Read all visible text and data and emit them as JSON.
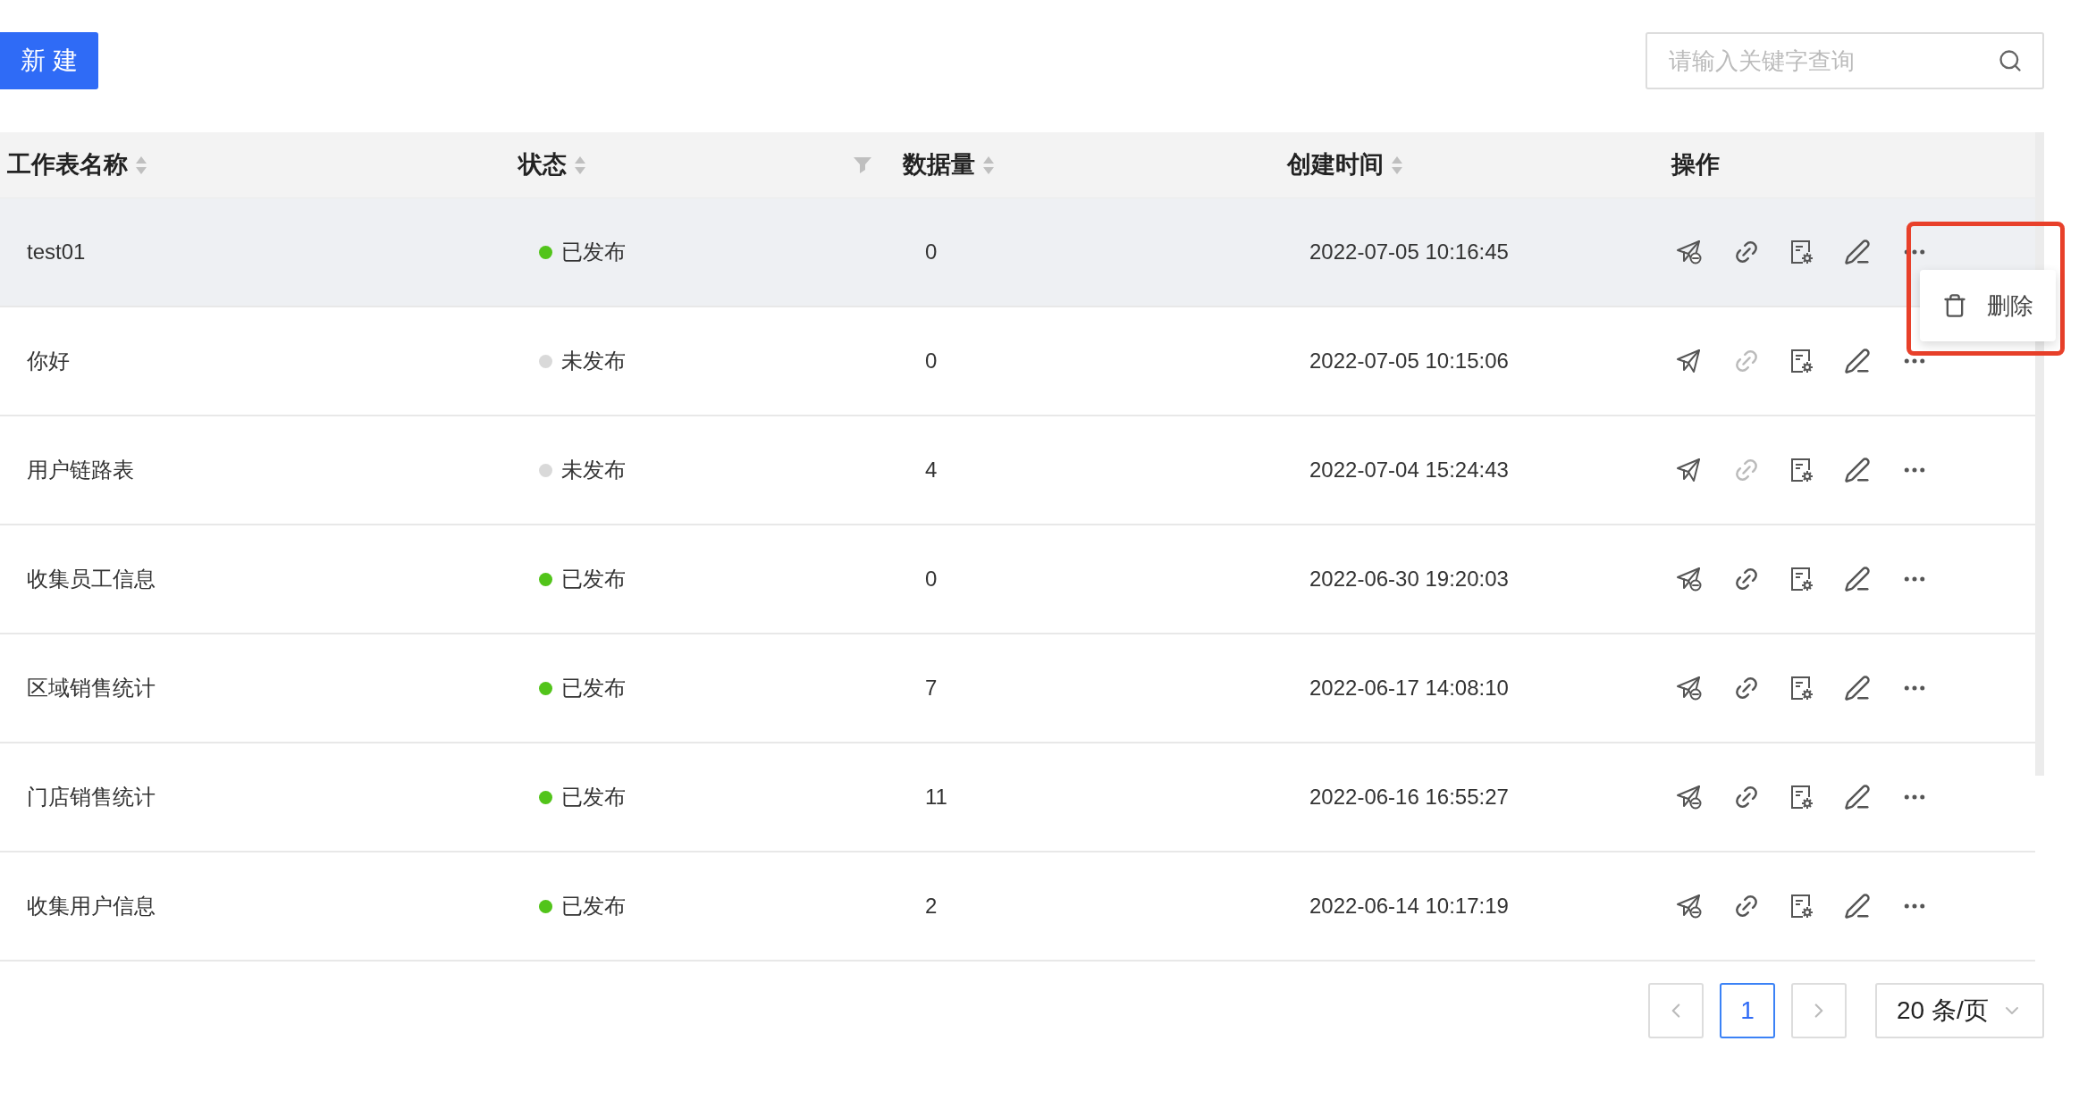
{
  "toolbar": {
    "new_button": "新 建",
    "search": {
      "placeholder": "请输入关键字查询"
    }
  },
  "table": {
    "columns": [
      {
        "label": "工作表名称",
        "kind": "sort"
      },
      {
        "label": "状态",
        "kind": "sortfilter"
      },
      {
        "label": "数据量",
        "kind": "sort"
      },
      {
        "label": "创建时间",
        "kind": "sort"
      },
      {
        "label": "操作",
        "kind": "plain"
      }
    ],
    "rows": [
      {
        "name": "test01",
        "status": "已发布",
        "published": true,
        "count": "0",
        "created": "2022-07-05 10:16:45",
        "hovered": true
      },
      {
        "name": "你好",
        "status": "未发布",
        "published": false,
        "count": "0",
        "created": "2022-07-05 10:15:06",
        "hovered": false
      },
      {
        "name": "用户链路表",
        "status": "未发布",
        "published": false,
        "count": "4",
        "created": "2022-07-04 15:24:43",
        "hovered": false
      },
      {
        "name": "收集员工信息",
        "status": "已发布",
        "published": true,
        "count": "0",
        "created": "2022-06-30 19:20:03",
        "hovered": false
      },
      {
        "name": "区域销售统计",
        "status": "已发布",
        "published": true,
        "count": "7",
        "created": "2022-06-17 14:08:10",
        "hovered": false
      },
      {
        "name": "门店销售统计",
        "status": "已发布",
        "published": true,
        "count": "11",
        "created": "2022-06-16 16:55:27",
        "hovered": false
      },
      {
        "name": "收集用户信息",
        "status": "已发布",
        "published": true,
        "count": "2",
        "created": "2022-06-14 10:17:19",
        "hovered": false
      }
    ]
  },
  "row_menu": {
    "items": [
      {
        "label": "删除"
      }
    ]
  },
  "pagination": {
    "pages": [
      {
        "label": "1",
        "selected": true
      }
    ],
    "page_size": "20 条/页"
  }
}
